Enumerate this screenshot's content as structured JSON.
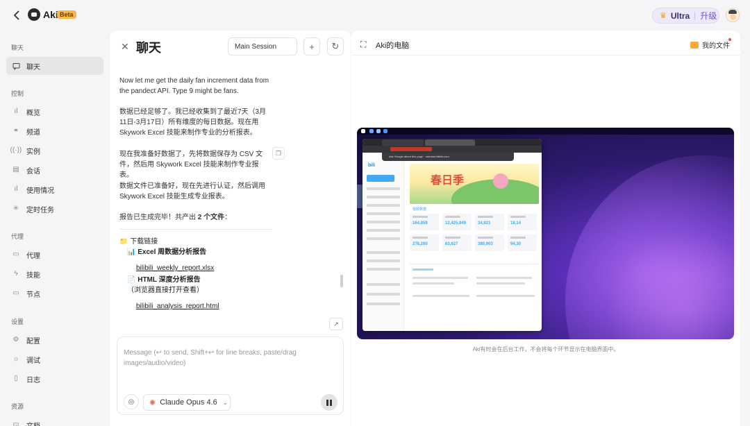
{
  "app": {
    "name": "Aki",
    "badge": "Beta"
  },
  "topbar": {
    "plan_label": "Ultra",
    "upgrade_label": "升级"
  },
  "sidebar": {
    "sections": [
      {
        "title": "聊天",
        "items": [
          {
            "label": "聊天",
            "icon": "chat-icon",
            "active": true
          }
        ]
      },
      {
        "title": "控制",
        "items": [
          {
            "label": "概览",
            "icon": "bar-chart-icon"
          },
          {
            "label": "频道",
            "icon": "link-icon"
          },
          {
            "label": "实例",
            "icon": "signal-icon"
          },
          {
            "label": "会话",
            "icon": "document-icon"
          },
          {
            "label": "使用情况",
            "icon": "bar-chart-icon"
          },
          {
            "label": "定时任务",
            "icon": "loader-icon"
          }
        ]
      },
      {
        "title": "代理",
        "items": [
          {
            "label": "代理",
            "icon": "folder-icon"
          },
          {
            "label": "技能",
            "icon": "bolt-icon"
          },
          {
            "label": "节点",
            "icon": "monitor-icon"
          }
        ]
      },
      {
        "title": "设置",
        "items": [
          {
            "label": "配置",
            "icon": "gear-icon"
          },
          {
            "label": "调试",
            "icon": "bug-icon"
          },
          {
            "label": "日志",
            "icon": "log-icon"
          }
        ]
      },
      {
        "title": "资源",
        "items": [
          {
            "label": "文档",
            "icon": "book-icon"
          }
        ]
      }
    ]
  },
  "chat": {
    "title": "聊天",
    "session": "Main Session",
    "messages": [
      "Now let me get the daily fan increment data from the pandect API. Type 9 might be fans.",
      "数据已经足够了。我已经收集到了最近7天（3月11日-3月17日）所有维度的每日数据。现在用 Skywork Excel 技能来制作专业的分析报表。",
      "现在我准备好数据了，先将数据保存为 CSV 文件，然后用 Skywork Excel 技能来制作专业报表。",
      "数据文件已准备好，现在先进行认证，然后调用 Skywork Excel 技能生成专业报表。"
    ],
    "report_done": {
      "prefix": "报告已生成完毕！共产出 ",
      "count": "2 个文件",
      "suffix": "："
    },
    "downloads": {
      "heading": "📁 下载链接",
      "excel_title": "📊 Excel 周数据分析报告",
      "excel_file": "bilibili_weekly_report.xlsx",
      "html_title": "📄 HTML 深度分析报告",
      "html_note": "（浏览器直接打开查看）",
      "html_file": "bilibili_analysis_report.html"
    },
    "input_placeholder": "Message (↩ to send, Shift+↩ for line breaks, paste/drag images/audio/video)",
    "model": "Claude Opus 4.6"
  },
  "computer": {
    "title": "Aki的电脑",
    "files_label": "我的文件",
    "caption": "Aki有时会在后台工作，不会将每个环节显示在电脑界面中。",
    "screen": {
      "popup_text": "Ask Google about this page · member.bilibili.com",
      "banner_text": "春日季",
      "tab_data": "视频数据",
      "stats": [
        "164,859",
        "12,425,949",
        "34,921",
        "18,14",
        "278,260",
        "63,627",
        "380,903",
        "94,30"
      ]
    }
  }
}
